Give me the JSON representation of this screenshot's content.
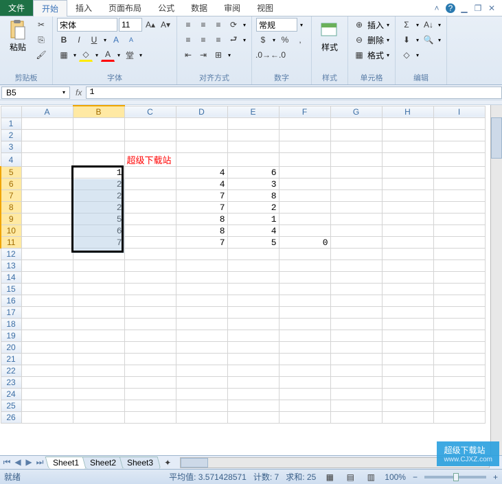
{
  "tabs": {
    "file": "文件",
    "home": "开始",
    "insert": "插入",
    "layout": "页面布局",
    "formula": "公式",
    "data": "数据",
    "review": "审阅",
    "view": "视图"
  },
  "ribbon": {
    "clipboard": {
      "label": "剪贴板",
      "paste": "粘贴"
    },
    "font": {
      "label": "字体",
      "name": "宋体",
      "size": "11",
      "bold": "B",
      "italic": "I",
      "underline": "U"
    },
    "align": {
      "label": "对齐方式"
    },
    "number": {
      "label": "数字",
      "format": "常规",
      "percent": "%",
      "comma": ","
    },
    "styles": {
      "label": "样式",
      "btn": "样式"
    },
    "cells": {
      "label": "单元格",
      "insert": "插入",
      "delete": "删除",
      "format": "格式"
    },
    "editing": {
      "label": "编辑",
      "sigma": "Σ"
    }
  },
  "namebox": "B5",
  "formula_value": "1",
  "columns": [
    "A",
    "B",
    "C",
    "D",
    "E",
    "F",
    "G",
    "H",
    "I"
  ],
  "rows_count": 26,
  "selected_col": 1,
  "selected_rows": [
    5,
    11
  ],
  "cells": {
    "C4": {
      "v": "超级下载站",
      "txt": true
    },
    "B5": {
      "v": "1"
    },
    "D5": {
      "v": "4"
    },
    "E5": {
      "v": "6"
    },
    "B6": {
      "v": "2"
    },
    "D6": {
      "v": "4"
    },
    "E6": {
      "v": "3"
    },
    "B7": {
      "v": "2"
    },
    "D7": {
      "v": "7"
    },
    "E7": {
      "v": "8"
    },
    "B8": {
      "v": "2"
    },
    "D8": {
      "v": "7"
    },
    "E8": {
      "v": "2"
    },
    "B9": {
      "v": "5"
    },
    "D9": {
      "v": "8"
    },
    "E9": {
      "v": "1"
    },
    "B10": {
      "v": "6"
    },
    "D10": {
      "v": "8"
    },
    "E10": {
      "v": "4"
    },
    "B11": {
      "v": "7"
    },
    "D11": {
      "v": "7"
    },
    "E11": {
      "v": "5"
    },
    "F11": {
      "v": "0"
    }
  },
  "sheets": [
    "Sheet1",
    "Sheet2",
    "Sheet3"
  ],
  "status": {
    "ready": "就绪",
    "avg_lbl": "平均值:",
    "avg": "3.571428571",
    "cnt_lbl": "计数:",
    "cnt": "7",
    "sum_lbl": "求和:",
    "sum": "25",
    "zoom": "100%"
  },
  "watermark": {
    "t1": "超级下载站",
    "t2": "www.CJXZ.com"
  }
}
